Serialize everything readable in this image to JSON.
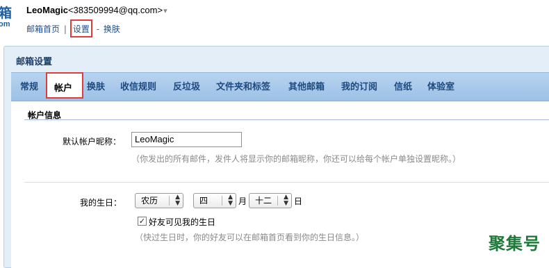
{
  "brand": {
    "logo_char": "箱",
    "logo_sub": "om"
  },
  "user": {
    "name": "LeoMagic",
    "email": "<383509994@qq.com>",
    "arrow": "▾"
  },
  "top_links": {
    "home": "邮箱首页",
    "sep1": "|",
    "settings": "设置",
    "sep2": "-",
    "skin": "换肤"
  },
  "settings": {
    "title": "邮箱设置"
  },
  "tabs": [
    {
      "label": "常规"
    },
    {
      "label": "帐户"
    },
    {
      "label": "换肤"
    },
    {
      "label": "收信规则"
    },
    {
      "label": "反垃圾"
    },
    {
      "label": "文件夹和标签"
    },
    {
      "label": "其他邮箱"
    },
    {
      "label": "我的订阅"
    },
    {
      "label": "信纸"
    },
    {
      "label": "体验室"
    }
  ],
  "account": {
    "section_title": "帐户信息",
    "nickname_label": "默认帐户昵称：",
    "nickname_value": "LeoMagic",
    "nickname_hint": "（你发出的所有邮件，发件人将显示你的邮箱昵称，你还可以给每个帐户单独设置昵称。）",
    "birthday_label": "我的生日：",
    "calendar_value": "农历",
    "month_value": "四",
    "month_unit": "月",
    "day_value": "十二",
    "day_unit": "日",
    "friends_visible_label": "好友可见我的生日",
    "friends_visible_checked": true,
    "birthday_hint": "（快过生日时，你的好友可以在邮箱首页看到你的生日信息。）"
  },
  "watermark": "聚集号",
  "colors": {
    "accent": "#1d4a80",
    "highlight": "#e03a3a",
    "tabbar": "#a9c9ea"
  }
}
